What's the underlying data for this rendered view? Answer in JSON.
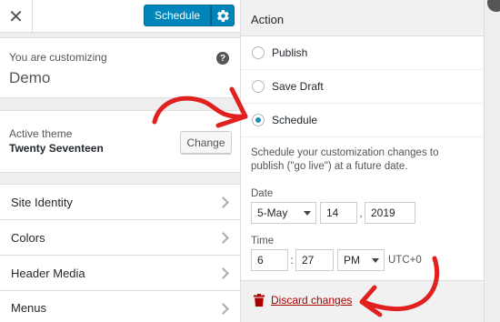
{
  "topbar": {
    "close_glyph": "✕",
    "schedule_label": "Schedule",
    "gear_icon": "gear-icon"
  },
  "customizing": {
    "label": "You are customizing",
    "title": "Demo",
    "help_glyph": "?"
  },
  "theme": {
    "label": "Active theme",
    "name": "Twenty Seventeen",
    "change_label": "Change"
  },
  "sections": [
    "Site Identity",
    "Colors",
    "Header Media",
    "Menus"
  ],
  "action": {
    "heading": "Action",
    "options": [
      {
        "label": "Publish",
        "selected": false
      },
      {
        "label": "Save Draft",
        "selected": false
      },
      {
        "label": "Schedule",
        "selected": true
      }
    ],
    "description": "Schedule your customization changes to publish (\"go live\") at a future date.",
    "date_label": "Date",
    "month": "5-May",
    "day": "14",
    "year": "2019",
    "date_sep": ",",
    "time_label": "Time",
    "hour": "6",
    "time_sep": ":",
    "minute": "27",
    "ampm": "PM",
    "timezone": "UTC+0",
    "discard_label": "Discard changes"
  },
  "colors": {
    "accent": "#0085ba",
    "arrow": "#e0211f",
    "discard": "#aa0000"
  }
}
